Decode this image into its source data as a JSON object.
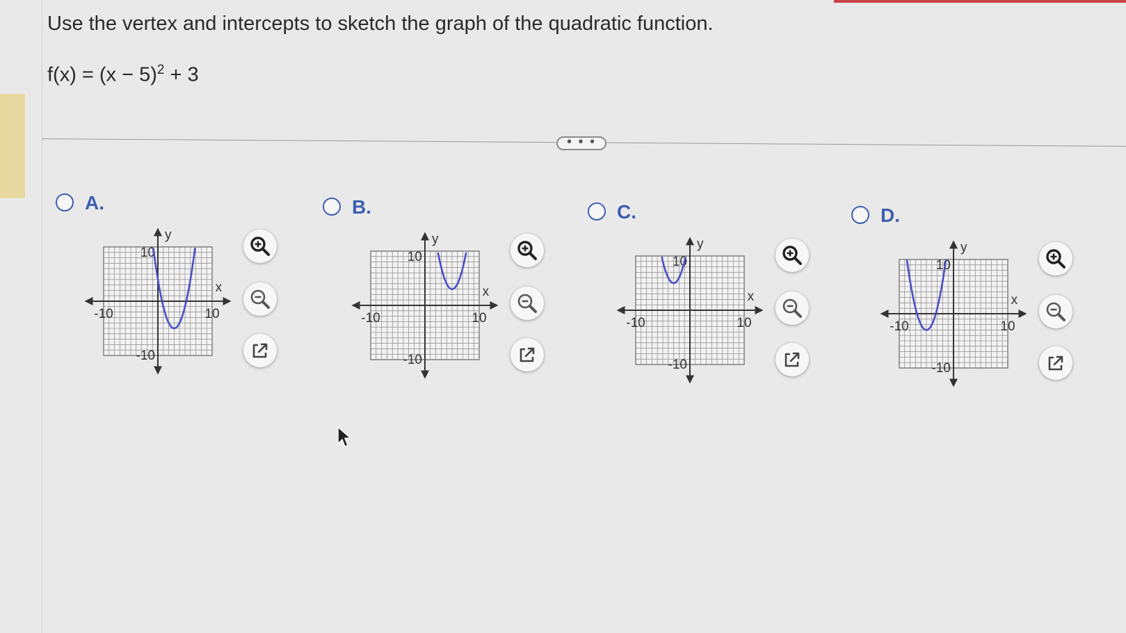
{
  "question": {
    "prompt": "Use the vertex and intercepts to sketch the graph of the quadratic function.",
    "function_main": "f(x) = (x − 5)",
    "function_exp": "2",
    "function_tail": " + 3"
  },
  "more_button": "• • •",
  "axis": {
    "x_label": "x",
    "y_label": "y",
    "pos_tick": "10",
    "neg_tick": "-10"
  },
  "options": [
    {
      "label": "A.",
      "vertex": [
        3,
        -5
      ]
    },
    {
      "label": "B.",
      "vertex": [
        5,
        3
      ]
    },
    {
      "label": "C.",
      "vertex": [
        -3,
        5
      ]
    },
    {
      "label": "D.",
      "vertex": [
        -5,
        -3
      ]
    }
  ],
  "icons": [
    "zoom-in-icon",
    "zoom-out-icon",
    "external-link-icon"
  ],
  "colors": {
    "accent": "#3d5fb0",
    "curve": "#4a4fc4",
    "grid": "#777777"
  }
}
